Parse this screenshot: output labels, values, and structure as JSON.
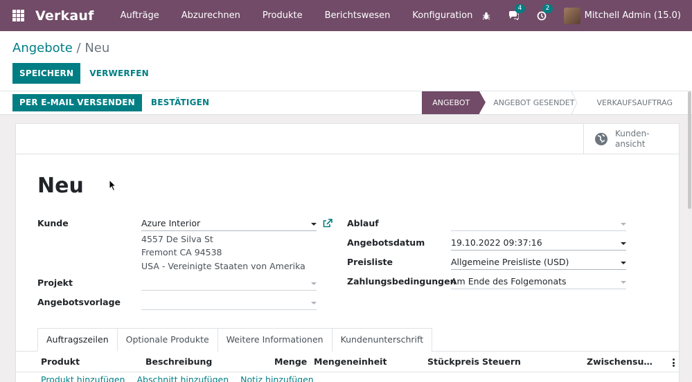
{
  "navbar": {
    "app_name": "Verkauf",
    "menu": [
      "Aufträge",
      "Abzurechnen",
      "Produkte",
      "Berichtswesen",
      "Konfiguration"
    ],
    "messages_count": "4",
    "activities_count": "2",
    "user": "Mitchell Admin (15.0)",
    "color": "#714b67"
  },
  "breadcrumb": {
    "parent": "Angebote",
    "separator": "/",
    "current": "Neu"
  },
  "control_panel": {
    "save_label": "SPEICHERN",
    "discard_label": "VERWERFEN"
  },
  "statusbar": {
    "send_email_label": "PER E-MAIL VERSENDEN",
    "confirm_label": "BESTÄTIGEN",
    "stages": [
      "ANGEBOT",
      "ANGEBOT GESENDET",
      "VERKAUFSAUFTRAG"
    ],
    "active_stage": "ANGEBOT"
  },
  "smart_button": {
    "line1": "Kunden-",
    "line2": "ansicht"
  },
  "record": {
    "title": "Neu"
  },
  "fields": {
    "customer": {
      "label": "Kunde",
      "value": "Azure Interior",
      "address": [
        "4557 De Silva St",
        "Fremont CA 94538",
        "USA - Vereinigte Staaten von Amerika"
      ]
    },
    "project": {
      "label": "Projekt",
      "value": ""
    },
    "template": {
      "label": "Angebotsvorlage",
      "value": ""
    },
    "expiration": {
      "label": "Ablauf",
      "value": ""
    },
    "quote_date": {
      "label": "Angebotsdatum",
      "value": "19.10.2022 09:37:16"
    },
    "pricelist": {
      "label": "Preisliste",
      "value": "Allgemeine Preisliste (USD)"
    },
    "payment_terms": {
      "label": "Zahlungsbedingungen",
      "value": "Am Ende des Folgemonats"
    }
  },
  "tabs": [
    "Auftragszeilen",
    "Optionale Produkte",
    "Weitere Informationen",
    "Kundenunterschrift"
  ],
  "order_lines": {
    "columns": [
      "Produkt",
      "Beschreibung",
      "Menge",
      "Mengeneinheit",
      "Stückpreis",
      "Steuern",
      "Zwischensu…"
    ],
    "add_links": [
      "Produkt hinzufügen",
      "Abschnitt hinzufügen",
      "Notiz hinzufügen"
    ]
  },
  "colors": {
    "primary": "#017e84",
    "brand": "#714b67"
  }
}
